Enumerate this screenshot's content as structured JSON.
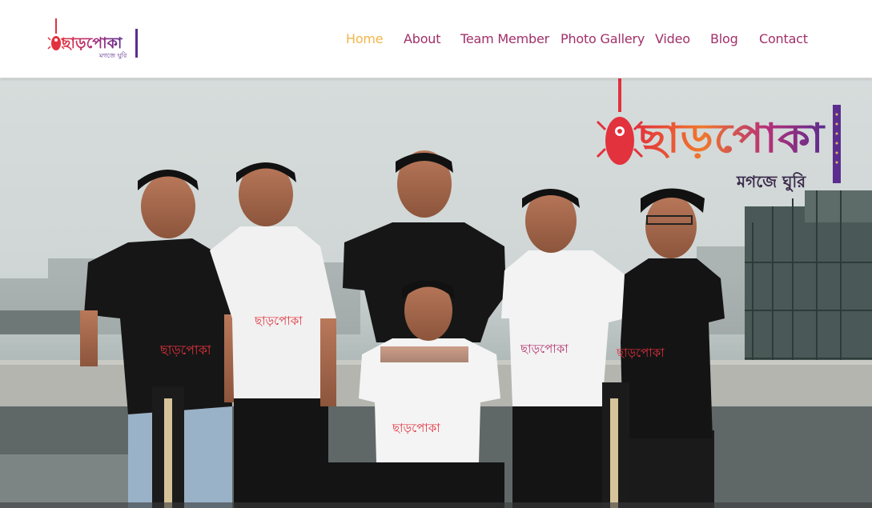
{
  "site": {
    "logo_text": "ছাড়পোকা",
    "logo_tagline": "মগজে ঘুরি"
  },
  "nav": {
    "items": [
      {
        "label": "Home",
        "active": true
      },
      {
        "label": "About",
        "active": false
      },
      {
        "label": "Team Member",
        "active": false
      },
      {
        "label": "Photo Gallery",
        "active": false
      },
      {
        "label": "Video",
        "active": false
      },
      {
        "label": "Blog",
        "active": false
      },
      {
        "label": "Contact",
        "active": false
      }
    ]
  },
  "hero": {
    "banner_logo_text": "ছাড়পোকা",
    "banner_logo_tagline": "মগজে ঘুরি",
    "shirt_text": "ছাড়পোকা"
  },
  "colors": {
    "nav_text": "#a0306a",
    "nav_active": "#f3b548",
    "brand_red": "#e2323d",
    "brand_purple": "#5b2d8e",
    "brand_orange": "#f0782c"
  }
}
